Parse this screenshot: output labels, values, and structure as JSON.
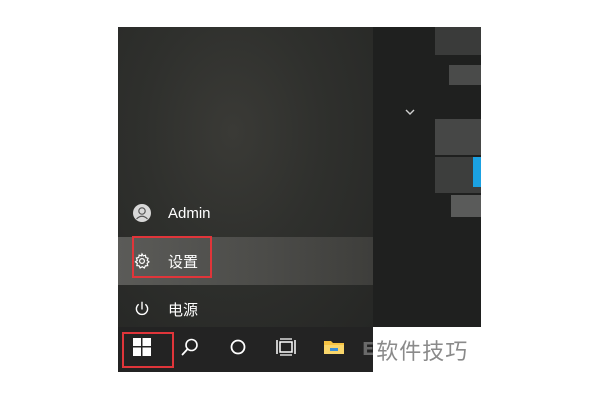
{
  "start_menu": {
    "user": {
      "label": "Admin",
      "icon": "user-icon"
    },
    "settings": {
      "label": "设置",
      "icon": "gear-icon"
    },
    "power": {
      "label": "电源",
      "icon": "power-icon"
    }
  },
  "taskbar": {
    "buttons": [
      {
        "name": "start",
        "icon": "windows-logo-icon"
      },
      {
        "name": "search",
        "icon": "search-icon"
      },
      {
        "name": "cortana",
        "icon": "circle-icon"
      },
      {
        "name": "task-view",
        "icon": "task-view-icon"
      },
      {
        "name": "file-explorer",
        "icon": "folder-icon"
      }
    ]
  },
  "tiles": {
    "expand_icon": "chevron-down-icon"
  },
  "watermark": {
    "logo": "E",
    "text": "软件技巧"
  },
  "colors": {
    "highlight": "#e0353a",
    "menu_bg": "#2f302d",
    "taskbar_bg": "#232323",
    "tile_accent": "#1ba1e2"
  }
}
